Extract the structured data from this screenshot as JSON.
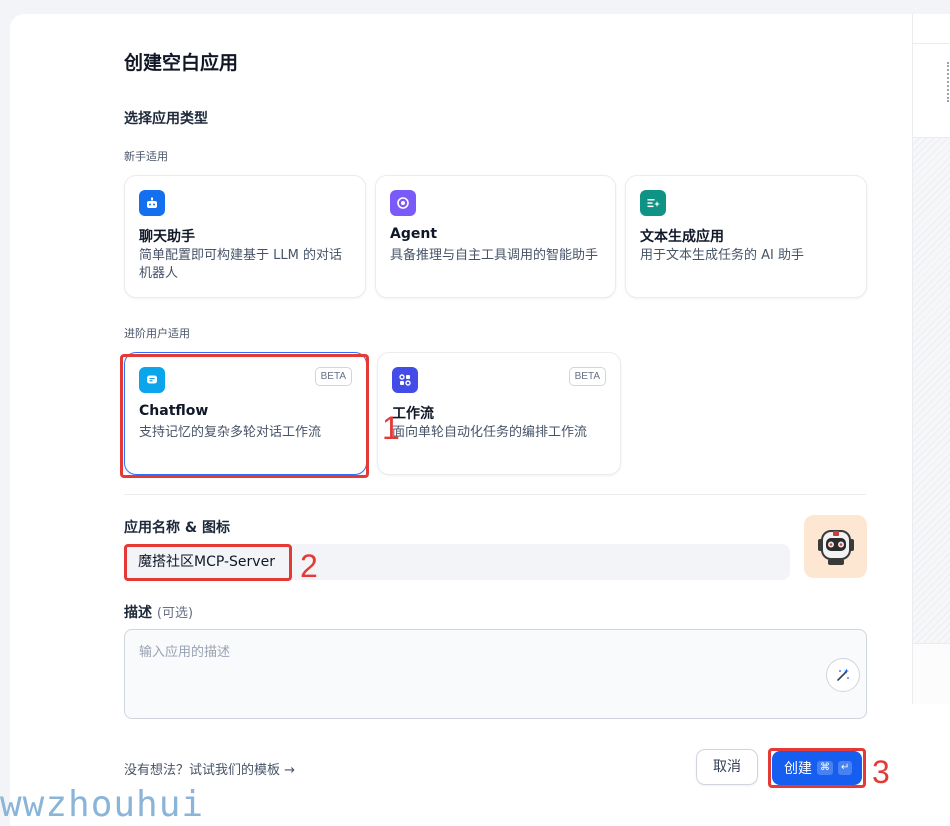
{
  "dialog": {
    "title": "创建空白应用",
    "choose_type_label": "选择应用类型",
    "beginner_label": "新手适用",
    "advanced_label": "进阶用户适用"
  },
  "app_types": {
    "beginner": [
      {
        "title": "聊天助手",
        "desc": "简单配置即可构建基于 LLM 的对话机器人",
        "icon": "chat-bot-icon",
        "color": "#1570ef"
      },
      {
        "title": "Agent",
        "desc": "具备推理与自主工具调用的智能助手",
        "icon": "agent-icon",
        "color": "#7a5af8"
      },
      {
        "title": "文本生成应用",
        "desc": "用于文本生成任务的 AI 助手",
        "icon": "text-generation-icon",
        "color": "#0e9384"
      }
    ],
    "advanced": [
      {
        "title": "Chatflow",
        "desc": "支持记忆的复杂多轮对话工作流",
        "badge": "BETA",
        "icon": "chatflow-icon",
        "color": "#0ba5ec"
      },
      {
        "title": "工作流",
        "desc": "面向单轮自动化任务的编排工作流",
        "badge": "BETA",
        "icon": "workflow-icon",
        "color": "#444ce7"
      }
    ]
  },
  "name_section": {
    "label": "应用名称 & 图标",
    "value": "魔搭社区MCP-Server",
    "avatar_icon": "robot-avatar-icon"
  },
  "desc_section": {
    "label": "描述",
    "optional": "(可选)",
    "placeholder": "输入应用的描述"
  },
  "footer": {
    "template_link": "没有想法？试试我们的模板 →",
    "cancel": "取消",
    "create": "创建",
    "shortcut_cmd": "⌘",
    "shortcut_enter": "↵"
  },
  "annotations": [
    "1",
    "2",
    "3"
  ],
  "watermark": "wwzhouhui",
  "colors": {
    "primary": "#155eef",
    "highlight": "#e53935"
  }
}
